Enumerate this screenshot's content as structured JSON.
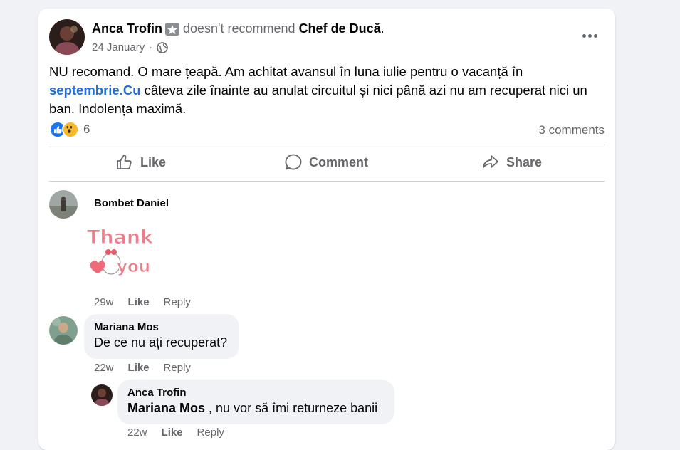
{
  "post": {
    "author": "Anca Trofin",
    "verb": "doesn't recommend",
    "page": "Chef de Ducă",
    "punct": ".",
    "date": "24 January",
    "dot": "·",
    "text_before_link": "NU recomand. O mare țeapă. Am achitat avansul  în luna iulie pentru o vacanță în ",
    "link_text": "septembrie.Cu",
    "text_after_link": " câteva zile înainte au anulat circuitul și nici până azi nu am recuperat nici un ban. Indolența maximă.",
    "reaction_count": "6",
    "comments_count": "3 comments",
    "reaction_icons": [
      "like-icon",
      "wow-icon"
    ],
    "colors": {
      "link": "#216fdb",
      "like": "#1877f2",
      "muted": "#65676b"
    }
  },
  "actions": {
    "like": "Like",
    "comment": "Comment",
    "share": "Share"
  },
  "comments": [
    {
      "name": "Bombet Daniel",
      "sticker_text_1": "Thank",
      "sticker_text_2": "you",
      "time": "29w",
      "like": "Like",
      "reply": "Reply"
    },
    {
      "name": "Mariana Mos",
      "text": "De ce nu ați recuperat?",
      "time": "22w",
      "like": "Like",
      "reply": "Reply"
    },
    {
      "name": "Anca Trofin",
      "mention": "Mariana Mos",
      "text": " , nu vor să îmi returneze banii",
      "time": "22w",
      "like": "Like",
      "reply": "Reply"
    }
  ]
}
